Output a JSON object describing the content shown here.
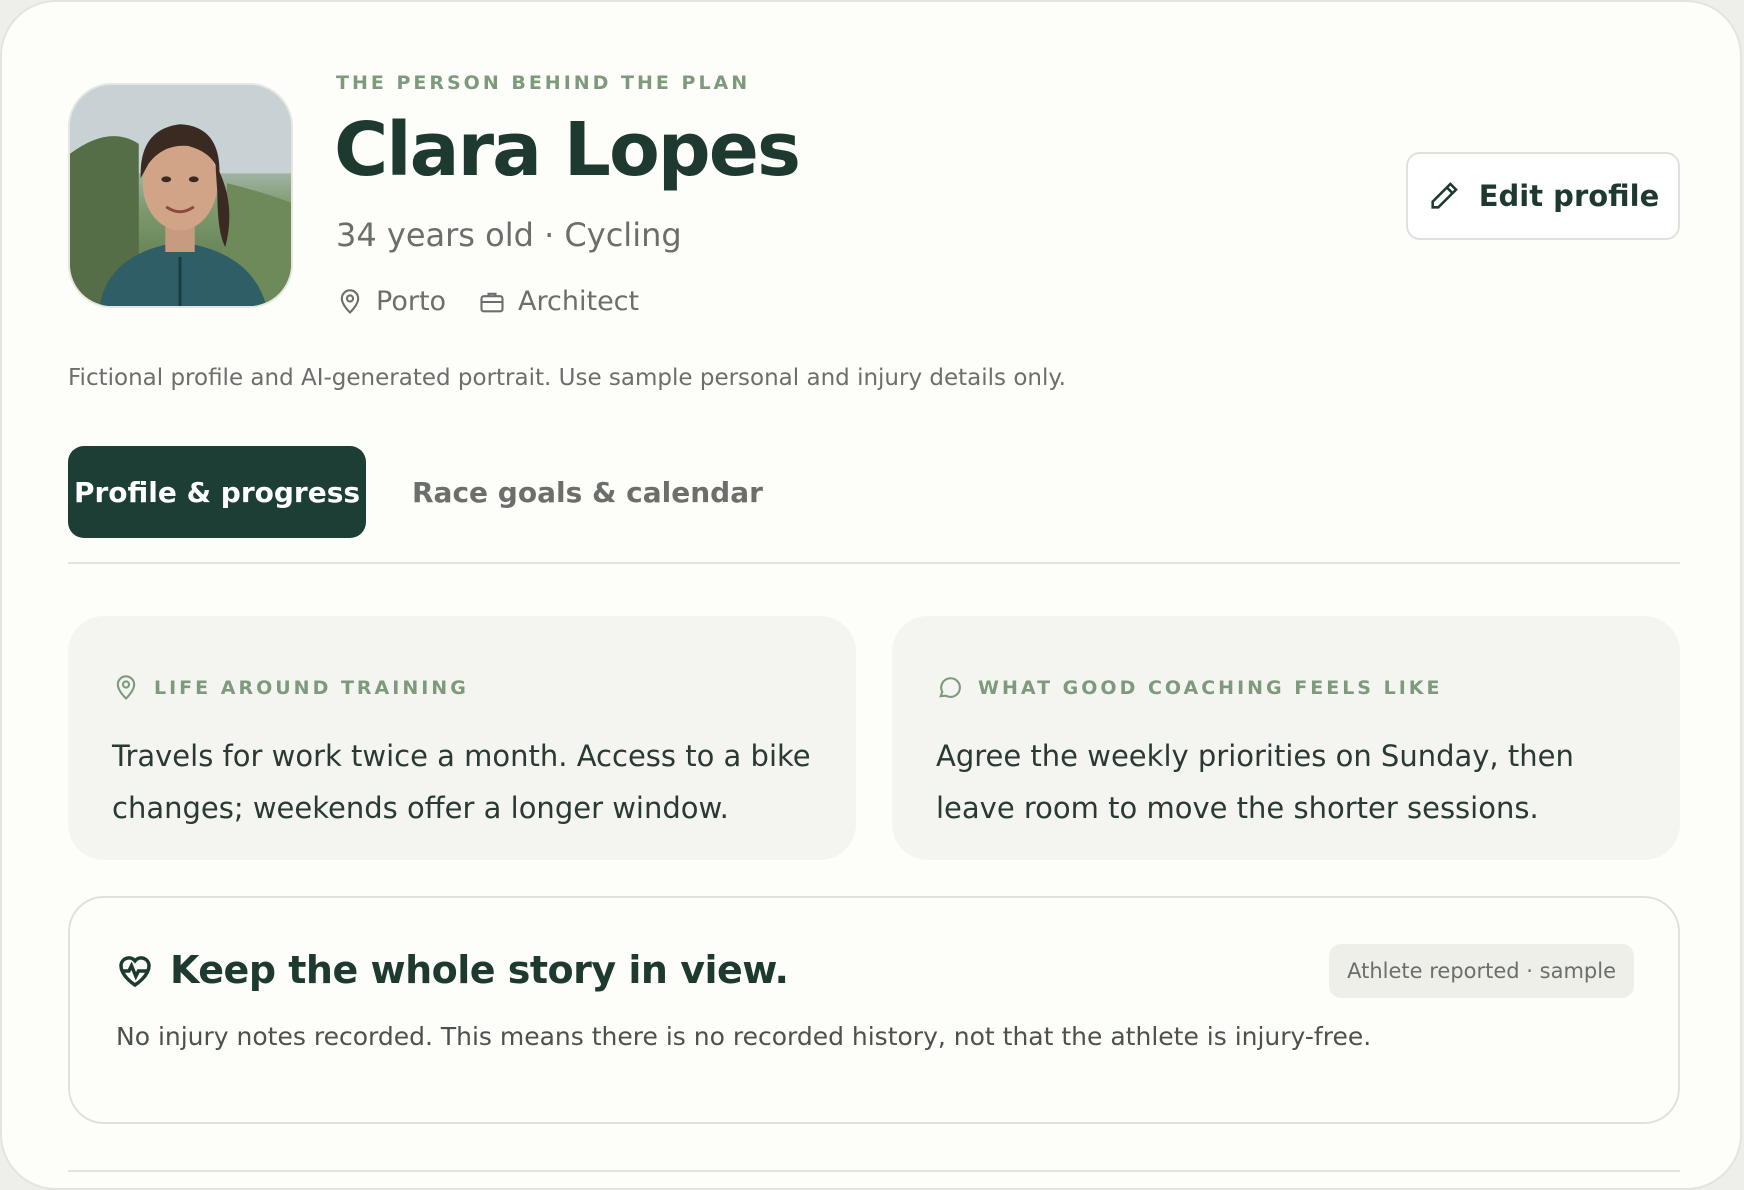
{
  "profile": {
    "eyebrow": "THE PERSON BEHIND THE PLAN",
    "name": "Clara Lopes",
    "subline": "34 years old · Cycling",
    "location": "Porto",
    "occupation": "Architect",
    "edit_label": "Edit profile",
    "disclaimer": "Fictional profile and AI-generated portrait. Use sample personal and injury details only."
  },
  "tabs": [
    {
      "label": "Profile & progress",
      "active": true
    },
    {
      "label": "Race goals & calendar",
      "active": false
    }
  ],
  "cards": {
    "life": {
      "label": "LIFE AROUND TRAINING",
      "icon": "map-pin-icon",
      "text": "Travels for work twice a month. Access to a bike changes; weekends offer a longer window."
    },
    "coaching": {
      "label": "WHAT GOOD COACHING FEELS LIKE",
      "icon": "chat-bubble-icon",
      "text": "Agree the weekly priorities on Sunday, then leave room to move the shorter sessions."
    }
  },
  "story": {
    "title": "Keep the whole story in view.",
    "badge": "Athlete reported · sample",
    "text": "No injury notes recorded. This means there is no recorded history, not that the athlete is injury-free."
  },
  "colors": {
    "primary": "#1d3e34",
    "accent_label": "#7e9a7c",
    "muted_text": "#6b6f6b",
    "card_bg": "#f4f4f0",
    "page_bg": "#fdfdfa"
  }
}
